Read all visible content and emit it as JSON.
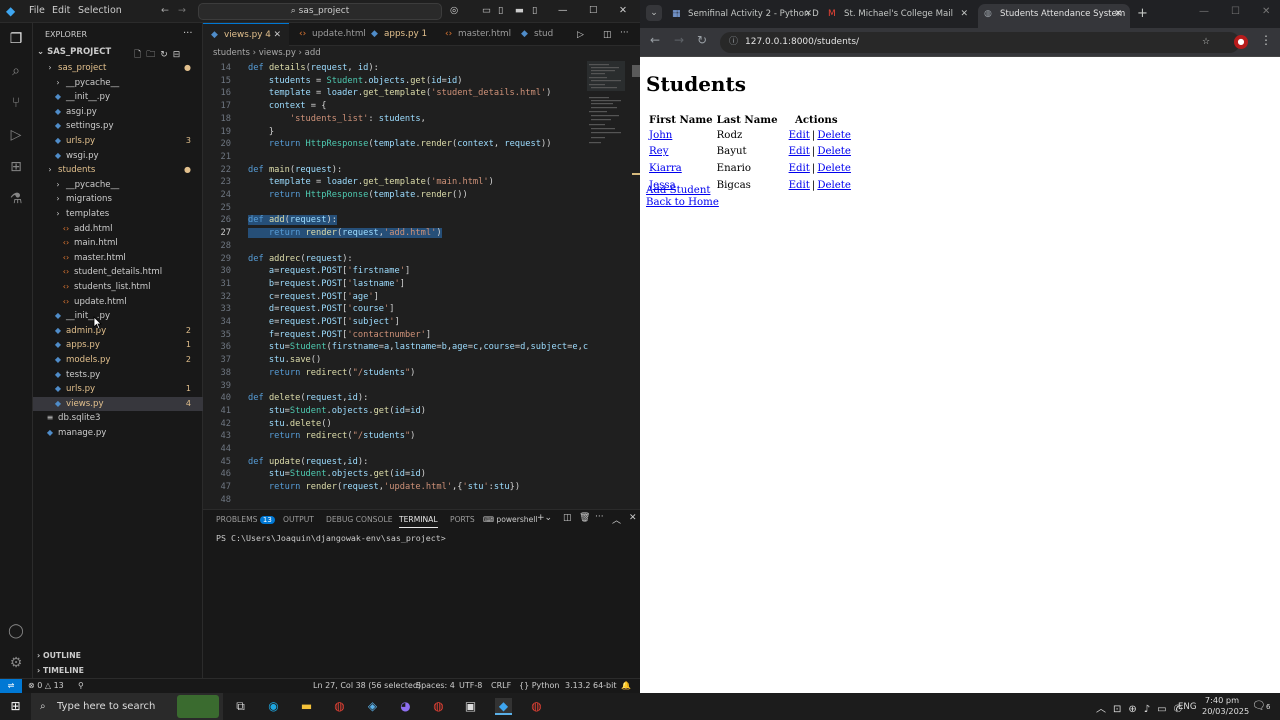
{
  "vscode": {
    "menu": [
      "File",
      "Edit",
      "Selection"
    ],
    "search": "sas_project",
    "sidebar": {
      "title": "EXPLORER",
      "root": "SAS_PROJECT",
      "items": [
        {
          "label": "sas_project",
          "type": "folder",
          "depth": 1,
          "mod": true
        },
        {
          "label": "__pycache__",
          "type": "folder",
          "depth": 2
        },
        {
          "label": "__init__.py",
          "type": "py",
          "depth": 2
        },
        {
          "label": "asgi.py",
          "type": "py",
          "depth": 2
        },
        {
          "label": "settings.py",
          "type": "py",
          "depth": 2
        },
        {
          "label": "urls.py",
          "type": "py",
          "depth": 2,
          "mod": true,
          "badge": "3"
        },
        {
          "label": "wsgi.py",
          "type": "py",
          "depth": 2
        },
        {
          "label": "students",
          "type": "folder",
          "depth": 1,
          "mod": true
        },
        {
          "label": "__pycache__",
          "type": "folder",
          "depth": 2
        },
        {
          "label": "migrations",
          "type": "folder",
          "depth": 2
        },
        {
          "label": "templates",
          "type": "folder",
          "depth": 2
        },
        {
          "label": "add.html",
          "type": "html",
          "depth": 3
        },
        {
          "label": "main.html",
          "type": "html",
          "depth": 3
        },
        {
          "label": "master.html",
          "type": "html",
          "depth": 3
        },
        {
          "label": "student_details.html",
          "type": "html",
          "depth": 3
        },
        {
          "label": "students_list.html",
          "type": "html",
          "depth": 3
        },
        {
          "label": "update.html",
          "type": "html",
          "depth": 3
        },
        {
          "label": "__init__.py",
          "type": "py",
          "depth": 2
        },
        {
          "label": "admin.py",
          "type": "py",
          "depth": 2,
          "mod": true,
          "badge": "2"
        },
        {
          "label": "apps.py",
          "type": "py",
          "depth": 2,
          "mod": true,
          "badge": "1"
        },
        {
          "label": "models.py",
          "type": "py",
          "depth": 2,
          "mod": true,
          "badge": "2"
        },
        {
          "label": "tests.py",
          "type": "py",
          "depth": 2
        },
        {
          "label": "urls.py",
          "type": "py",
          "depth": 2,
          "mod": true,
          "badge": "1"
        },
        {
          "label": "views.py",
          "type": "py",
          "depth": 2,
          "mod": true,
          "badge": "4",
          "selected": true
        },
        {
          "label": "db.sqlite3",
          "type": "db",
          "depth": 1
        },
        {
          "label": "manage.py",
          "type": "py",
          "depth": 1
        }
      ],
      "outline": "OUTLINE",
      "timeline": "TIMELINE"
    },
    "tabs": [
      {
        "label": "views.py 4",
        "active": true
      },
      {
        "label": "update.html"
      },
      {
        "label": "apps.py 1"
      },
      {
        "label": "master.html"
      },
      {
        "label": "stud"
      }
    ],
    "breadcrumb": "students  ›  views.py  ›  add",
    "code": [
      {
        "n": "14",
        "t": "def details(request, id):"
      },
      {
        "n": "15",
        "t": "    students = Student.objects.get(id=id)"
      },
      {
        "n": "16",
        "t": "    template = loader.get_template('student_details.html')"
      },
      {
        "n": "17",
        "t": "    context = {"
      },
      {
        "n": "18",
        "t": "        'students_list': students,"
      },
      {
        "n": "19",
        "t": "    }"
      },
      {
        "n": "20",
        "t": "    return HttpResponse(template.render(context, request))"
      },
      {
        "n": "21",
        "t": ""
      },
      {
        "n": "22",
        "t": "def main(request):"
      },
      {
        "n": "23",
        "t": "    template = loader.get_template('main.html')"
      },
      {
        "n": "24",
        "t": "    return HttpResponse(template.render())"
      },
      {
        "n": "25",
        "t": ""
      },
      {
        "n": "26",
        "t": "def add(request):",
        "hl": true
      },
      {
        "n": "27",
        "t": "    return render(request,'add.html')",
        "hl": true
      },
      {
        "n": "28",
        "t": ""
      },
      {
        "n": "29",
        "t": "def addrec(request):"
      },
      {
        "n": "30",
        "t": "    a=request.POST['firstname']"
      },
      {
        "n": "31",
        "t": "    b=request.POST['lastname']"
      },
      {
        "n": "32",
        "t": "    c=request.POST['age']"
      },
      {
        "n": "33",
        "t": "    d=request.POST['course']"
      },
      {
        "n": "34",
        "t": "    e=request.POST['subject']"
      },
      {
        "n": "35",
        "t": "    f=request.POST['contactnumber']"
      },
      {
        "n": "36",
        "t": "    stu=Student(firstname=a,lastname=b,age=c,course=d,subject=e,c"
      },
      {
        "n": "37",
        "t": "    stu.save()"
      },
      {
        "n": "38",
        "t": "    return redirect(\"/students\")"
      },
      {
        "n": "39",
        "t": ""
      },
      {
        "n": "40",
        "t": "def delete(request,id):"
      },
      {
        "n": "41",
        "t": "    stu=Student.objects.get(id=id)"
      },
      {
        "n": "42",
        "t": "    stu.delete()"
      },
      {
        "n": "43",
        "t": "    return redirect(\"/students\")"
      },
      {
        "n": "44",
        "t": ""
      },
      {
        "n": "45",
        "t": "def update(request,id):"
      },
      {
        "n": "46",
        "t": "    stu=Student.objects.get(id=id)"
      },
      {
        "n": "47",
        "t": "    return render(request,'update.html',{'stu':stu})"
      },
      {
        "n": "48",
        "t": ""
      }
    ],
    "panel": {
      "tabs": [
        "PROBLEMS",
        "OUTPUT",
        "DEBUG CONSOLE",
        "TERMINAL",
        "PORTS"
      ],
      "problems_count": "13",
      "active_tab": "TERMINAL",
      "shell": "powershell",
      "terminal_line": "PS C:\\Users\\Joaquin\\djangowak-env\\sas_project>"
    },
    "status": {
      "errors": "0",
      "warnings": "13",
      "position": "Ln 27, Col 38 (56 selected)",
      "spaces": "Spaces: 4",
      "encoding": "UTF-8",
      "eol": "CRLF",
      "language": "Python",
      "version": "3.13.2 64-bit"
    }
  },
  "chrome": {
    "tabs": [
      {
        "label": "Semifinal Activity 2 - Python D"
      },
      {
        "label": "St. Michael's College Mail"
      },
      {
        "label": "Students Attendance System",
        "active": true
      }
    ],
    "url": "127.0.0.1:8000/students/",
    "page": {
      "heading": "Students",
      "columns": [
        "First Name",
        "Last Name",
        "Actions"
      ],
      "rows": [
        {
          "first": "John",
          "last": "Rodz"
        },
        {
          "first": "Rey",
          "last": "Bayut"
        },
        {
          "first": "Kiarra",
          "last": "Enario"
        },
        {
          "first": "Jessa",
          "last": "Bigcas"
        }
      ],
      "edit_label": "Edit",
      "delete_label": "Delete",
      "separator": "|",
      "add_link": "Add Student",
      "home_link": "Back to Home"
    }
  },
  "taskbar": {
    "search_placeholder": "Type here to search",
    "lang": "ENG",
    "time": "7:40 pm",
    "date": "20/03/2025",
    "notifications": "6"
  }
}
